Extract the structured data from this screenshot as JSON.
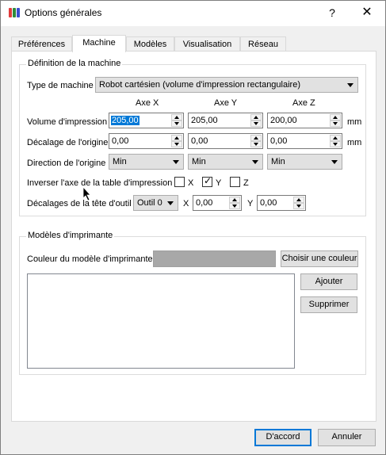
{
  "window": {
    "title": "Options générales",
    "help": "?",
    "close": "✕"
  },
  "tabs": [
    "Préférences",
    "Machine",
    "Modèles",
    "Visualisation",
    "Réseau"
  ],
  "machine": {
    "group_title": "Définition de la machine",
    "machine_type_label": "Type de machine",
    "machine_type_value": "Robot cartésien (volume d'impression rectangulaire)",
    "col_headers": [
      "Axe X",
      "Axe Y",
      "Axe Z"
    ],
    "build_volume_label": "Volume d'impression",
    "build_volume": [
      "205,00",
      "205,00",
      "200,00"
    ],
    "origin_offset_label": "Décalage de l'origine",
    "origin_offset": [
      "0,00",
      "0,00",
      "0,00"
    ],
    "unit": "mm",
    "origin_direction_label": "Direction de l'origine",
    "origin_direction": [
      "Min",
      "Min",
      "Min"
    ],
    "invert_axis_label": "Inverser l'axe de la table d'impression",
    "invert_axes": [
      {
        "label": "X",
        "checked": false
      },
      {
        "label": "Y",
        "checked": true
      },
      {
        "label": "Z",
        "checked": false
      }
    ],
    "checkmark": "✓",
    "tool_offsets_label": "Décalages de la tête d'outil",
    "tool_value": "Outil 0",
    "tool_x_label": "X",
    "tool_x": "0,00",
    "tool_y_label": "Y",
    "tool_y": "0,00"
  },
  "printer_models": {
    "group_title": "Modèles d'imprimante",
    "color_label": "Couleur du modèle d'imprimante",
    "color_value": "#a8a8a8",
    "choose_color_button": "Choisir une couleur",
    "add_button": "Ajouter",
    "delete_button": "Supprimer"
  },
  "footer": {
    "ok_button": "D'accord",
    "cancel_button": "Annuler"
  },
  "colors": {
    "accent": "#0078d7",
    "selection": "#0078d7"
  }
}
